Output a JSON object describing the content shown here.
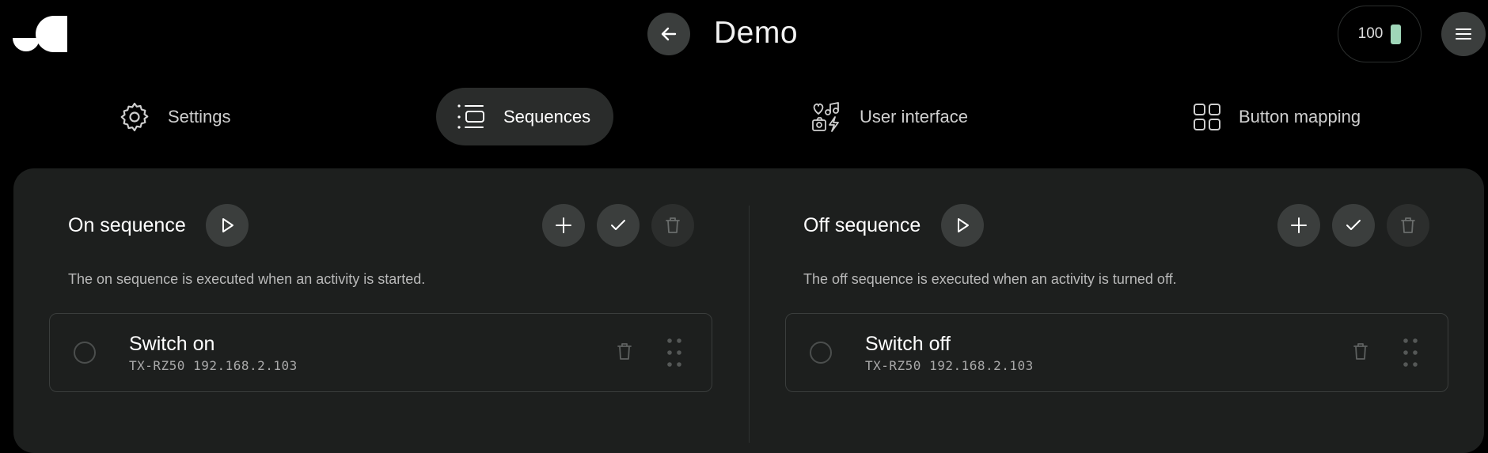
{
  "header": {
    "title": "Demo",
    "battery_value": "100",
    "icons": [
      "logo-icon",
      "arrow-left-icon",
      "battery-icon",
      "menu-icon"
    ]
  },
  "tabs": [
    {
      "label": "Settings",
      "icon": "gear-icon",
      "active": false
    },
    {
      "label": "Sequences",
      "icon": "list-icon",
      "active": true
    },
    {
      "label": "User interface",
      "icon": "media-icon",
      "active": false
    },
    {
      "label": "Button mapping",
      "icon": "grid-icon",
      "active": false
    }
  ],
  "on_sequence": {
    "title": "On sequence",
    "description": "The on sequence is executed when an activity is started.",
    "items": [
      {
        "name": "Switch on",
        "device": "TX-RZ50 192.168.2.103"
      }
    ]
  },
  "off_sequence": {
    "title": "Off sequence",
    "description": "The off sequence is executed when an activity is turned off.",
    "items": [
      {
        "name": "Switch off",
        "device": "TX-RZ50 192.168.2.103"
      }
    ]
  },
  "colors": {
    "background": "#000000",
    "panel": "#1d1f1e",
    "button": "#3b3e3d",
    "battery": "#9fd6b8"
  }
}
